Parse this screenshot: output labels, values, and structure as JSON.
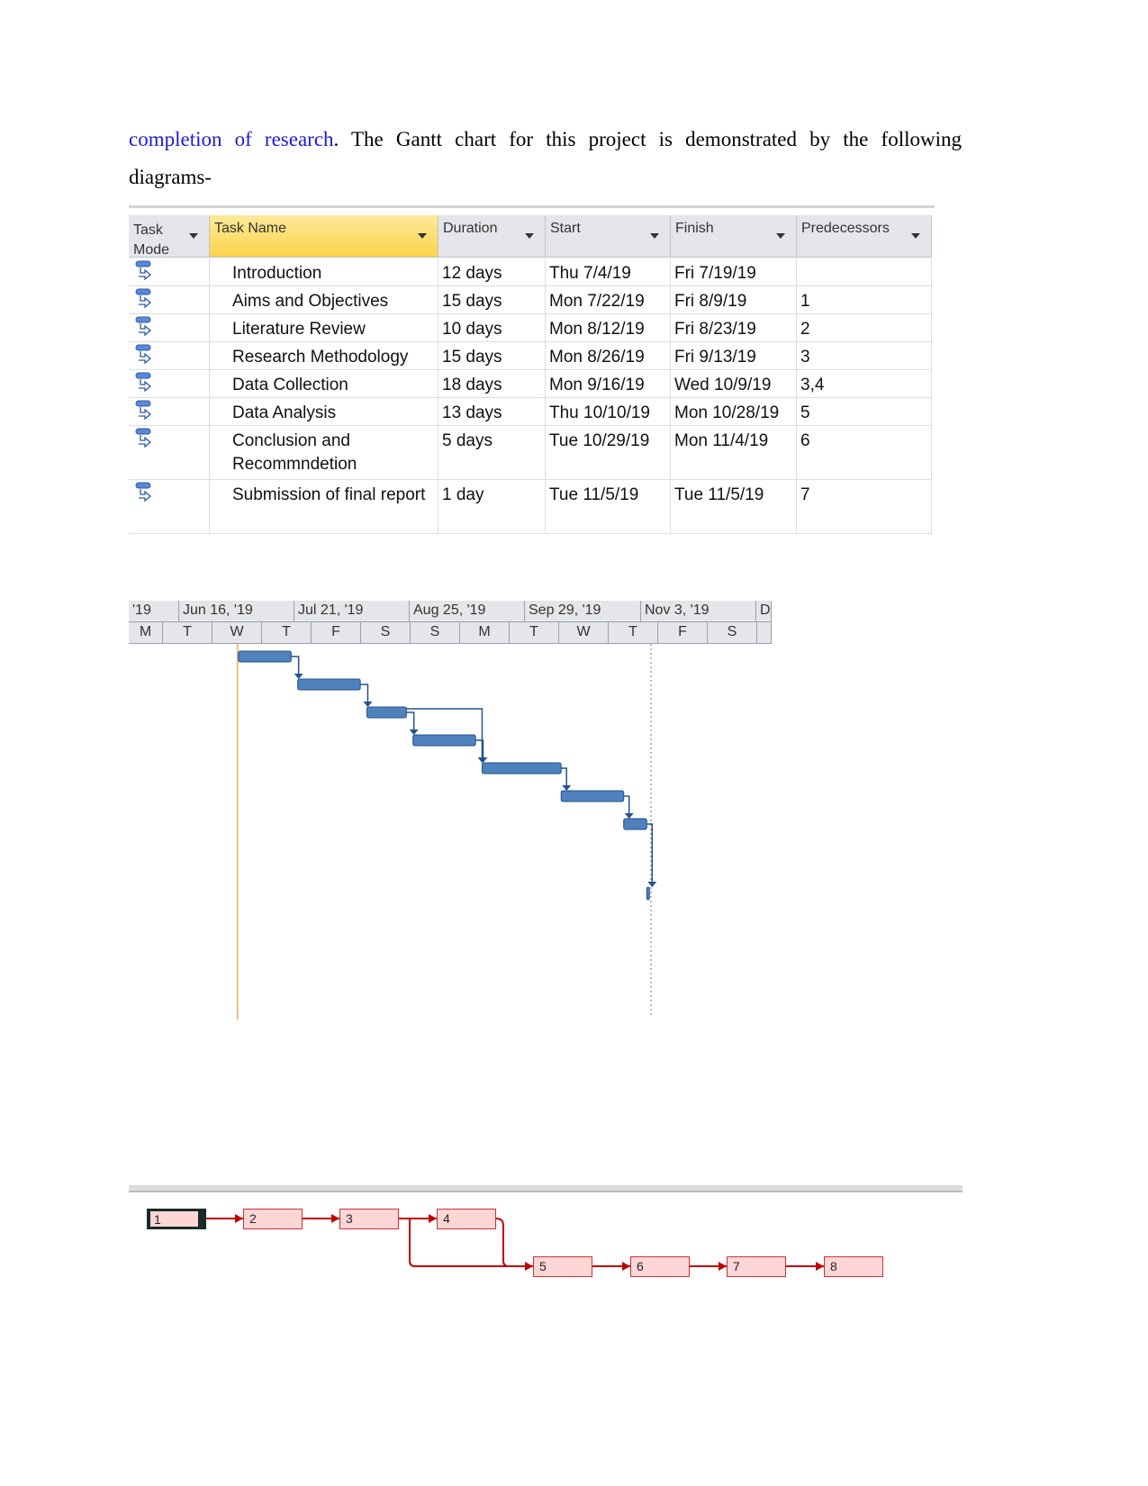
{
  "text": {
    "link": "completion of research",
    "rest": ". The Gantt chart for this project is demonstrated by the following",
    "line2": "diagrams-",
    "link_color": "#1a1adb"
  },
  "table": {
    "headers": [
      "Task Mode",
      "Task Name",
      "Duration",
      "Start",
      "Finish",
      "Predecessors"
    ],
    "rows": [
      {
        "name": "Introduction",
        "duration": "12 days",
        "start": "Thu 7/4/19",
        "finish": "Fri 7/19/19",
        "pred": ""
      },
      {
        "name": "Aims and Objectives",
        "duration": "15 days",
        "start": "Mon 7/22/19",
        "finish": "Fri 8/9/19",
        "pred": "1"
      },
      {
        "name": "Literature Review",
        "duration": "10 days",
        "start": "Mon 8/12/19",
        "finish": "Fri 8/23/19",
        "pred": "2"
      },
      {
        "name": "Research Methodology",
        "duration": "15 days",
        "start": "Mon 8/26/19",
        "finish": "Fri 9/13/19",
        "pred": "3"
      },
      {
        "name": "Data Collection",
        "duration": "18 days",
        "start": "Mon 9/16/19",
        "finish": "Wed 10/9/19",
        "pred": "3,4"
      },
      {
        "name": "Data Analysis",
        "duration": "13 days",
        "start": "Thu 10/10/19",
        "finish": "Mon 10/28/19",
        "pred": "5"
      },
      {
        "name": "Conclusion and Recommndetion",
        "duration": "5 days",
        "start": "Tue 10/29/19",
        "finish": "Mon 11/4/19",
        "pred": "6"
      },
      {
        "name": "Submission of final report",
        "duration": "1 day",
        "start": "Tue 11/5/19",
        "finish": "Tue 11/5/19",
        "pred": "7"
      }
    ]
  },
  "gantt": {
    "top_tier": [
      "'19",
      "Jun 16, '19",
      "Jul 21, '19",
      "Aug 25, '19",
      "Sep 29, '19",
      "Nov 3, '19",
      "D"
    ],
    "bottom_tier": [
      "M",
      "T",
      "W",
      "T",
      "F",
      "S",
      "S",
      "M",
      "T",
      "W",
      "T",
      "F",
      "S",
      ""
    ],
    "bar_color": "#4f81bd",
    "tasks": [
      {
        "start": "2019-07-04",
        "finish": "2019-07-19"
      },
      {
        "start": "2019-07-22",
        "finish": "2019-08-09"
      },
      {
        "start": "2019-08-12",
        "finish": "2019-08-23"
      },
      {
        "start": "2019-08-26",
        "finish": "2019-09-13"
      },
      {
        "start": "2019-09-16",
        "finish": "2019-10-09"
      },
      {
        "start": "2019-10-10",
        "finish": "2019-10-28"
      },
      {
        "start": "2019-10-29",
        "finish": "2019-11-04"
      },
      {
        "start": "2019-11-05",
        "finish": "2019-11-05"
      }
    ]
  },
  "network": {
    "nodes": [
      "1",
      "2",
      "3",
      "4",
      "5",
      "6",
      "7",
      "8"
    ],
    "node_color": "#ffd6d6",
    "link_color": "#c00000"
  }
}
